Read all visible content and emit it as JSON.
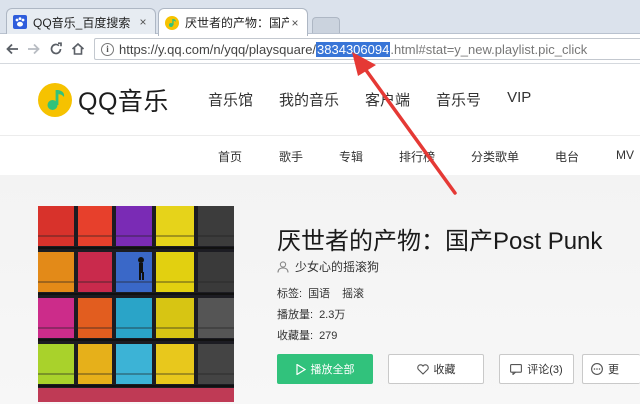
{
  "browser": {
    "tabs": [
      {
        "title": "QQ音乐_百度搜索",
        "close": "×"
      },
      {
        "title": "厌世者的产物：国产Post",
        "close": "×"
      }
    ],
    "url_prefix": "https://y.qq.com/n/yqq/playsquare/",
    "url_selected": "3834306094",
    "url_suffix": ".html#stat=y_new.playlist.pic_click",
    "info_icon": "i"
  },
  "site": {
    "logo_text": "QQ音乐",
    "main_nav": [
      "音乐馆",
      "我的音乐",
      "客户端",
      "音乐号",
      "VIP"
    ],
    "sub_nav": [
      "首页",
      "歌手",
      "专辑",
      "排行榜",
      "分类歌单",
      "电台",
      "MV"
    ]
  },
  "playlist": {
    "title": "厌世者的产物：国产Post Punk",
    "creator": "少女心的摇滚狗",
    "tags_label": "标签:",
    "tags": [
      "国语",
      "摇滚"
    ],
    "plays_label": "播放量:",
    "plays": "2.3万",
    "favs_label": "收藏量:",
    "favs": "279"
  },
  "actions": {
    "play_all": "播放全部",
    "favorite": "收藏",
    "comment": "评论(3)",
    "more": "更"
  },
  "colors": {
    "accent_green": "#31c27c",
    "annotation_red": "#e53935",
    "selection_blue": "#3875d7"
  }
}
